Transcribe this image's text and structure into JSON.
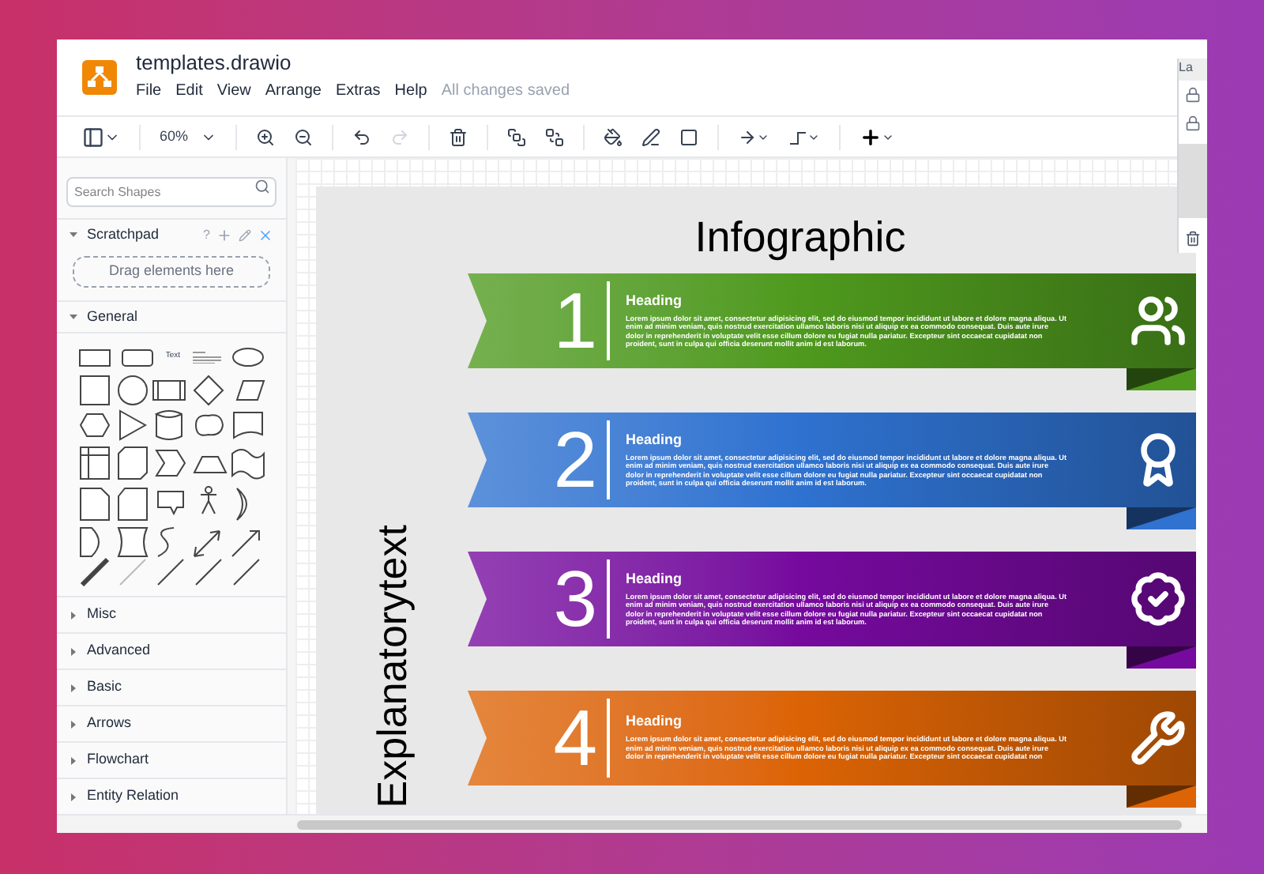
{
  "window": {
    "title": "templates.drawio",
    "status": "All changes saved"
  },
  "menu": [
    "File",
    "Edit",
    "View",
    "Arrange",
    "Extras",
    "Help"
  ],
  "toolbar": {
    "zoom": "60%",
    "items": [
      {
        "kind": "undo",
        "disabled": false
      },
      {
        "kind": "redo",
        "disabled": true
      }
    ]
  },
  "sidebar": {
    "search": {
      "placeholder": "Search Shapes"
    },
    "scratchpad": {
      "title": "Scratchpad",
      "expanded": true,
      "help": "?",
      "drop_hint": "Drag elements here"
    },
    "general": {
      "title": "General",
      "expanded": true,
      "text_shape": "Text"
    },
    "sections": [
      {
        "title": "Misc",
        "expanded": false
      },
      {
        "title": "Advanced",
        "expanded": false
      },
      {
        "title": "Basic",
        "expanded": false
      },
      {
        "title": "Arrows",
        "expanded": false
      },
      {
        "title": "Flowchart",
        "expanded": false
      },
      {
        "title": "Entity Relation",
        "expanded": false
      }
    ]
  },
  "format_panel": {
    "tab": "La"
  },
  "diagram": {
    "title": "Infographic",
    "side_text": "Explanatorytext",
    "items": [
      {
        "number": "1",
        "heading": "Heading",
        "kind": "people",
        "color": "#4f9a1e",
        "body": "Lorem ipsum dolor sit amet, consectetur adipisicing elit, sed do eiusmod tempor incididunt ut labore et dolore magna aliqua. Ut enim ad minim veniam, quis nostrud exercitation ullamco laboris nisi ut aliquip ex ea commodo consequat. Duis aute irure dolor in reprehenderit in voluptate velit esse cillum dolore eu fugiat nulla pariatur. Excepteur sint occaecat cupidatat non proident, sunt in culpa qui officia deserunt mollit anim id est laborum."
      },
      {
        "number": "2",
        "heading": "Heading",
        "kind": "award",
        "color": "#2f72d0",
        "body": "Lorem ipsum dolor sit amet, consectetur adipisicing elit, sed do eiusmod tempor incididunt ut labore et dolore magna aliqua. Ut enim ad minim veniam, quis nostrud exercitation ullamco laboris nisi ut aliquip ex ea commodo consequat. Duis aute irure dolor in reprehenderit in voluptate velit esse cillum dolore eu fugiat nulla pariatur. Excepteur sint occaecat cupidatat non proident, sunt in culpa qui officia deserunt mollit anim id est laborum."
      },
      {
        "number": "3",
        "heading": "Heading",
        "kind": "badge",
        "color": "#760a9e",
        "body": "Lorem ipsum dolor sit amet, consectetur adipisicing elit, sed do eiusmod tempor incididunt ut labore et dolore magna aliqua. Ut enim ad minim veniam, quis nostrud exercitation ullamco laboris nisi ut aliquip ex ea commodo consequat. Duis aute irure dolor in reprehenderit in voluptate velit esse cillum dolore eu fugiat nulla pariatur. Excepteur sint occaecat cupidatat non proident, sunt in culpa qui officia deserunt mollit anim id est laborum."
      },
      {
        "number": "4",
        "heading": "Heading",
        "kind": "tools",
        "color": "#dc6405",
        "body": "Lorem ipsum dolor sit amet, consectetur adipisicing elit, sed do eiusmod tempor incididunt ut labore et dolore magna aliqua. Ut enim ad minim veniam, quis nostrud exercitation ullamco laboris nisi ut aliquip ex ea commodo consequat. Duis aute irure dolor in reprehenderit in voluptate velit esse cillum dolore eu fugiat nulla pariatur. Excepteur sint occaecat cupidatat non"
      }
    ]
  }
}
